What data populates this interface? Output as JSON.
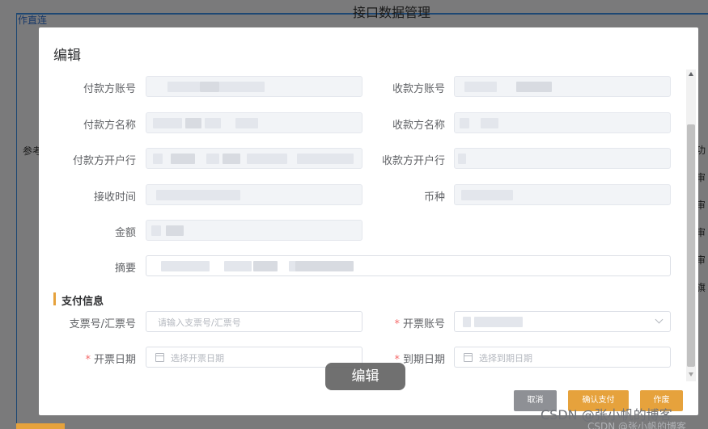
{
  "background": {
    "top_link": "作直连",
    "page_title": "接口数据管理",
    "ref_label": "参考",
    "right_chars": [
      "功",
      "审",
      "审",
      "审",
      "审",
      "旗"
    ]
  },
  "dialog": {
    "title": "编辑",
    "fields": {
      "payer_account": {
        "label": "付款方账号"
      },
      "payee_account": {
        "label": "收款方账号"
      },
      "payer_name": {
        "label": "付款方名称"
      },
      "payee_name": {
        "label": "收款方名称"
      },
      "payer_bank": {
        "label": "付款方开户行"
      },
      "payee_bank": {
        "label": "收款方开户行"
      },
      "receive_time": {
        "label": "接收时间"
      },
      "currency": {
        "label": "币种"
      },
      "amount": {
        "label": "金额"
      },
      "summary": {
        "label": "摘要"
      }
    },
    "section_title": "支付信息",
    "payment": {
      "check_number": {
        "label": "支票号/汇票号",
        "placeholder": "请输入支票号/汇票号"
      },
      "invoice_account": {
        "label": "开票账号",
        "required_mark": "*"
      },
      "invoice_date": {
        "label": "开票日期",
        "placeholder": "选择开票日期",
        "required_mark": "*"
      },
      "due_date": {
        "label": "到期日期",
        "placeholder": "选择到期日期",
        "required_mark": "*"
      }
    },
    "buttons": {
      "cancel": "取消",
      "confirm_pay": "确认支付",
      "void": "作废"
    }
  },
  "tooltip": "编辑",
  "watermark": "CSDN @张小帆的博客",
  "watermark_faint": "CSDN @张小帆的博客"
}
